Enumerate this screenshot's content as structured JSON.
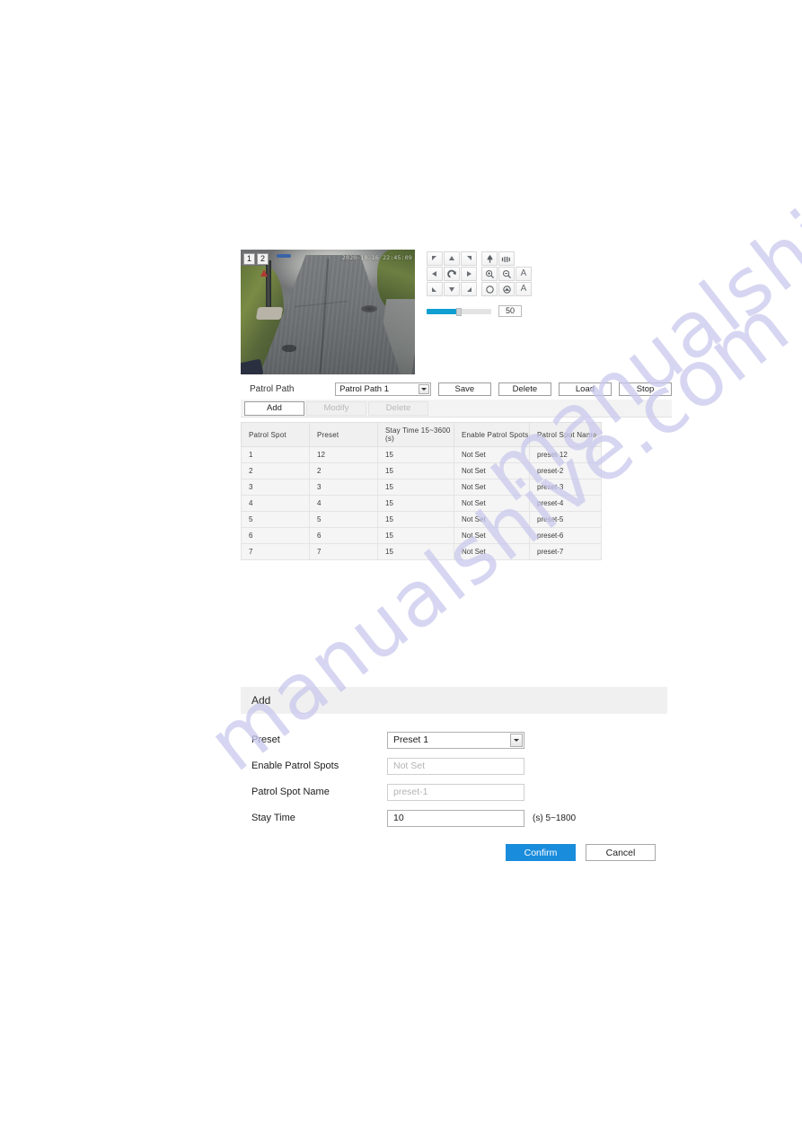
{
  "live_view": {
    "osd_timestamp": "2020-10-16 22:45:09",
    "badges": [
      "1",
      "2"
    ],
    "scene_alt": "live-video-preview"
  },
  "ptz": {
    "direction_buttons": [
      {
        "name": "pan-up-left",
        "glyph": "◤"
      },
      {
        "name": "pan-up",
        "glyph": "▲"
      },
      {
        "name": "pan-up-right",
        "glyph": "◥"
      },
      {
        "name": "pan-left",
        "glyph": "◀"
      },
      {
        "name": "auto-scan",
        "glyph": "↻"
      },
      {
        "name": "pan-right",
        "glyph": "▶"
      },
      {
        "name": "pan-down-left",
        "glyph": "◣"
      },
      {
        "name": "pan-down",
        "glyph": "▼"
      },
      {
        "name": "pan-down-right",
        "glyph": "◢"
      }
    ],
    "optic_buttons": [
      {
        "name": "zoom-auto-icon",
        "glyph": "☲"
      },
      {
        "name": "lens-initialize-icon",
        "glyph": "≡"
      },
      {
        "name": "zoom-in-icon",
        "glyph": "⊕"
      },
      {
        "name": "zoom-out-icon",
        "glyph": "⊖"
      },
      {
        "name": "focus-near-icon",
        "glyph": "A"
      },
      {
        "name": "iris-open-icon",
        "glyph": "○"
      },
      {
        "name": "iris-close-icon",
        "glyph": "●"
      },
      {
        "name": "focus-far-icon",
        "glyph": "A"
      }
    ],
    "speed": {
      "value": "50",
      "fill_percent": 50,
      "accent_color": "#0f9fd0"
    }
  },
  "patrol_path": {
    "label": "Patrol Path",
    "selected": "Patrol Path 1",
    "buttons": {
      "save": "Save",
      "delete": "Delete",
      "load": "Load",
      "stop": "Stop"
    }
  },
  "spot_toolbar": {
    "add": "Add",
    "modify": "Modify",
    "delete": "Delete"
  },
  "spot_table": {
    "headers": [
      "Patrol Spot",
      "Preset",
      "Stay Time 15~3600 (s)",
      "Enable Patrol Spots",
      "Patrol Spot Name"
    ],
    "rows": [
      {
        "spot": "1",
        "preset": "12",
        "stay": "15",
        "enable": "Not Set",
        "name": "preset-12"
      },
      {
        "spot": "2",
        "preset": "2",
        "stay": "15",
        "enable": "Not Set",
        "name": "preset-2"
      },
      {
        "spot": "3",
        "preset": "3",
        "stay": "15",
        "enable": "Not Set",
        "name": "preset-3"
      },
      {
        "spot": "4",
        "preset": "4",
        "stay": "15",
        "enable": "Not Set",
        "name": "preset-4"
      },
      {
        "spot": "5",
        "preset": "5",
        "stay": "15",
        "enable": "Not Set",
        "name": "preset-5"
      },
      {
        "spot": "6",
        "preset": "6",
        "stay": "15",
        "enable": "Not Set",
        "name": "preset-6"
      },
      {
        "spot": "7",
        "preset": "7",
        "stay": "15",
        "enable": "Not Set",
        "name": "preset-7"
      }
    ]
  },
  "add_dialog": {
    "title": "Add",
    "fields": {
      "preset_label": "Preset",
      "preset_value": "Preset 1",
      "enable_label": "Enable Patrol Spots",
      "enable_placeholder": "Not Set",
      "spot_name_label": "Patrol Spot Name",
      "spot_name_placeholder": "preset-1",
      "stay_time_label": "Stay Time",
      "stay_time_value": "10",
      "stay_time_hint": "(s)  5~1800"
    },
    "confirm": "Confirm",
    "cancel": "Cancel",
    "confirm_color": "#1a8cdc"
  },
  "watermark": {
    "text": "manualshive.com",
    "color": "#c9c9ee"
  }
}
